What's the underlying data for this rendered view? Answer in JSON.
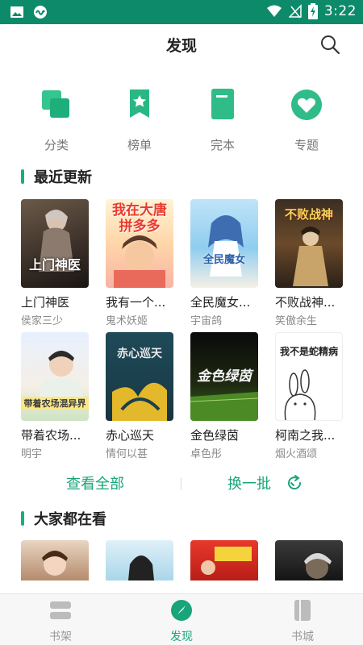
{
  "status": {
    "time": "3:22"
  },
  "header": {
    "title": "发现"
  },
  "categories": [
    {
      "label": "分类",
      "icon": "category-icon"
    },
    {
      "label": "榜单",
      "icon": "ranking-icon"
    },
    {
      "label": "完本",
      "icon": "completed-book-icon"
    },
    {
      "label": "专题",
      "icon": "heart-icon"
    }
  ],
  "recent": {
    "title": "最近更新",
    "books": [
      {
        "title": "上门神医",
        "author": "侯家三少",
        "cover_text": "上门神医"
      },
      {
        "title": "我有一个...",
        "author": "鬼术妖姬",
        "cover_text": "我在大唐拼多多"
      },
      {
        "title": "全民魔女...",
        "author": "宇宙鸽",
        "cover_text": "全民魔女"
      },
      {
        "title": "不败战神...",
        "author": "笑傲余生",
        "cover_text": "不败战神"
      },
      {
        "title": "带着农场...",
        "author": "明宇",
        "cover_text": "带着农场混异界"
      },
      {
        "title": "赤心巡天",
        "author": "情何以甚",
        "cover_text": "赤心巡天"
      },
      {
        "title": "金色绿茵",
        "author": "卓色彤",
        "cover_text": "金色绿茵"
      },
      {
        "title": "柯南之我...",
        "author": "烟火酒颂",
        "cover_text": "我不是蛇精病"
      }
    ],
    "view_all": "查看全部",
    "refresh": "换一批"
  },
  "popular": {
    "title": "大家都在看"
  },
  "nav": [
    {
      "label": "书架",
      "icon": "bookshelf-icon"
    },
    {
      "label": "发现",
      "icon": "compass-icon"
    },
    {
      "label": "书城",
      "icon": "bookstore-icon"
    }
  ],
  "colors": {
    "accent": "#1aa47a",
    "status_bar": "#0c8a6a"
  }
}
